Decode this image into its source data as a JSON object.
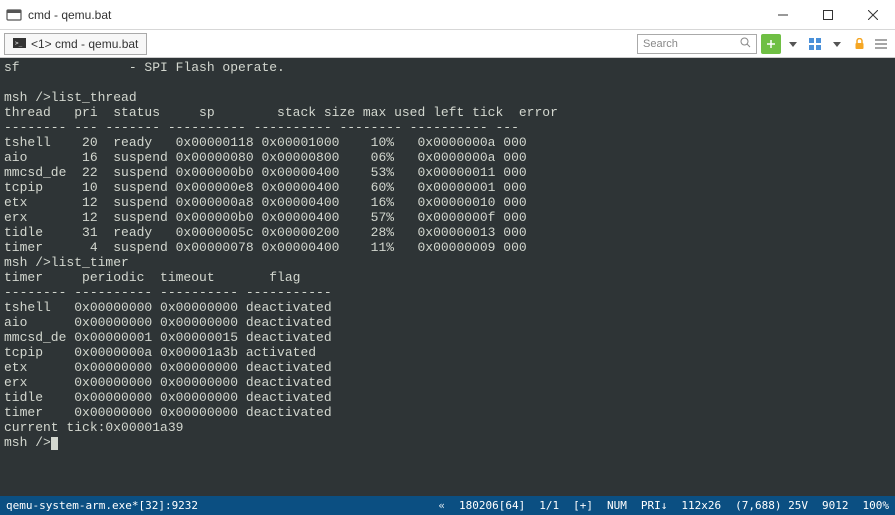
{
  "window": {
    "title": "cmd - qemu.bat"
  },
  "tab": {
    "label": "<1> cmd - qemu.bat"
  },
  "search": {
    "placeholder": "Search"
  },
  "terminal": {
    "top_cmd": "sf",
    "top_desc": "- SPI Flash operate.",
    "prompt1": "msh />",
    "cmd1": "list_thread",
    "thread_header": [
      "thread",
      "pri",
      "status",
      "sp",
      "stack size",
      "max used",
      "left tick",
      "error"
    ],
    "thread_divider": "-------- --- ------- ---------- ---------- -------- ---------- ---",
    "threads": [
      {
        "name": "tshell",
        "pri": "20",
        "status": "ready",
        "sp": "0x00000118",
        "size": "0x00001000",
        "max": "10%",
        "tick": "0x0000000a",
        "err": "000"
      },
      {
        "name": "aio",
        "pri": "16",
        "status": "suspend",
        "sp": "0x00000080",
        "size": "0x00000800",
        "max": "06%",
        "tick": "0x0000000a",
        "err": "000"
      },
      {
        "name": "mmcsd_de",
        "pri": "22",
        "status": "suspend",
        "sp": "0x000000b0",
        "size": "0x00000400",
        "max": "53%",
        "tick": "0x00000011",
        "err": "000"
      },
      {
        "name": "tcpip",
        "pri": "10",
        "status": "suspend",
        "sp": "0x000000e8",
        "size": "0x00000400",
        "max": "60%",
        "tick": "0x00000001",
        "err": "000"
      },
      {
        "name": "etx",
        "pri": "12",
        "status": "suspend",
        "sp": "0x000000a8",
        "size": "0x00000400",
        "max": "16%",
        "tick": "0x00000010",
        "err": "000"
      },
      {
        "name": "erx",
        "pri": "12",
        "status": "suspend",
        "sp": "0x000000b0",
        "size": "0x00000400",
        "max": "57%",
        "tick": "0x0000000f",
        "err": "000"
      },
      {
        "name": "tidle",
        "pri": "31",
        "status": "ready",
        "sp": "0x0000005c",
        "size": "0x00000200",
        "max": "28%",
        "tick": "0x00000013",
        "err": "000"
      },
      {
        "name": "timer",
        "pri": "4",
        "status": "suspend",
        "sp": "0x00000078",
        "size": "0x00000400",
        "max": "11%",
        "tick": "0x00000009",
        "err": "000"
      }
    ],
    "prompt2": "msh />",
    "cmd2": "list_timer",
    "timer_header": [
      "timer",
      "periodic",
      "timeout",
      "flag"
    ],
    "timer_divider": "-------- ---------- ---------- -----------",
    "timers": [
      {
        "name": "tshell",
        "periodic": "0x00000000",
        "timeout": "0x00000000",
        "flag": "deactivated"
      },
      {
        "name": "aio",
        "periodic": "0x00000000",
        "timeout": "0x00000000",
        "flag": "deactivated"
      },
      {
        "name": "mmcsd_de",
        "periodic": "0x00000001",
        "timeout": "0x00000015",
        "flag": "deactivated"
      },
      {
        "name": "tcpip",
        "periodic": "0x0000000a",
        "timeout": "0x00001a3b",
        "flag": "activated"
      },
      {
        "name": "etx",
        "periodic": "0x00000000",
        "timeout": "0x00000000",
        "flag": "deactivated"
      },
      {
        "name": "erx",
        "periodic": "0x00000000",
        "timeout": "0x00000000",
        "flag": "deactivated"
      },
      {
        "name": "tidle",
        "periodic": "0x00000000",
        "timeout": "0x00000000",
        "flag": "deactivated"
      },
      {
        "name": "timer",
        "periodic": "0x00000000",
        "timeout": "0x00000000",
        "flag": "deactivated"
      }
    ],
    "current_tick": "current tick:0x00001a39",
    "prompt3": "msh />"
  },
  "status": {
    "left": "qemu-system-arm.exe*[32]:9232",
    "dbl": "«",
    "seg1": "180206[64]",
    "seg2": "1/1",
    "seg3": "[+]",
    "seg4": "NUM",
    "seg5": "PRI↓",
    "seg6": "112x26",
    "seg7": "(7,688) 25V",
    "seg8": "9012",
    "seg9": "100%"
  }
}
